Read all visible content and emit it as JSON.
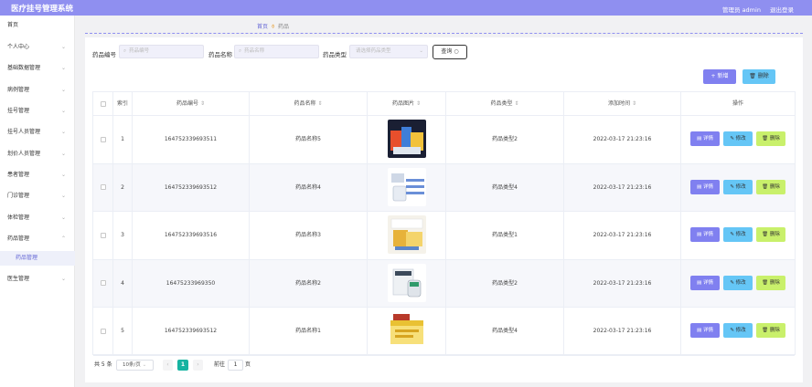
{
  "app": {
    "title": "医疗挂号管理系统",
    "admin": "管理员 admin",
    "logout": "退出登录"
  },
  "sidebar": {
    "items": [
      {
        "label": "首页",
        "chevron": false
      },
      {
        "label": "个人中心",
        "chevron": true
      },
      {
        "label": "基础数据管理",
        "chevron": true
      },
      {
        "label": "病例管理",
        "chevron": true
      },
      {
        "label": "挂号管理",
        "chevron": true
      },
      {
        "label": "挂号人员管理",
        "chevron": true
      },
      {
        "label": "划价人员管理",
        "chevron": true
      },
      {
        "label": "患者管理",
        "chevron": true
      },
      {
        "label": "门诊管理",
        "chevron": true
      },
      {
        "label": "体检管理",
        "chevron": true
      },
      {
        "label": "药品管理",
        "chevron": true
      },
      {
        "label": "医生管理",
        "chevron": true
      }
    ],
    "active_sub": "药品管理"
  },
  "breadcrumb": {
    "home": "首页",
    "current": "药品"
  },
  "filters": {
    "code_label": "药品编号",
    "code_placeholder": "药品编号",
    "name_label": "药品名称",
    "name_placeholder": "药品名称",
    "type_label": "药品类型",
    "type_placeholder": "请选择药品类型",
    "search_button": "查询"
  },
  "actions": {
    "add": "新增",
    "delete": "删除"
  },
  "table": {
    "headers": [
      "索引",
      "药品编号",
      "药品名称",
      "药品图片",
      "药品类型",
      "添加时间",
      "操作"
    ],
    "row_actions": {
      "detail": "详情",
      "edit": "修改",
      "remove": "删除"
    },
    "rows": [
      {
        "index": "1",
        "code": "164752339693511",
        "name": "药品名称5",
        "type": "药品类型2",
        "time": "2022-03-17 21:23:16"
      },
      {
        "index": "2",
        "code": "164752339693512",
        "name": "药品名称4",
        "type": "药品类型4",
        "time": "2022-03-17 21:23:16"
      },
      {
        "index": "3",
        "code": "164752339693516",
        "name": "药品名称3",
        "type": "药品类型1",
        "time": "2022-03-17 21:23:16"
      },
      {
        "index": "4",
        "code": "16475233969350",
        "name": "药品名称2",
        "type": "药品类型2",
        "time": "2022-03-17 21:23:16"
      },
      {
        "index": "5",
        "code": "164752339693512",
        "name": "药品名称1",
        "type": "药品类型4",
        "time": "2022-03-17 21:23:16"
      }
    ]
  },
  "pagination": {
    "total": "共 5 条",
    "page_size": "10条/页",
    "current_page": "1",
    "goto_label": "前往",
    "goto_value": "1",
    "page_unit": "页"
  },
  "colors": {
    "brand": "#8f8ff0",
    "primary": "#8080f0",
    "info": "#65c6f6",
    "danger": "#c9f06b",
    "pager_active": "#16b3a1"
  }
}
